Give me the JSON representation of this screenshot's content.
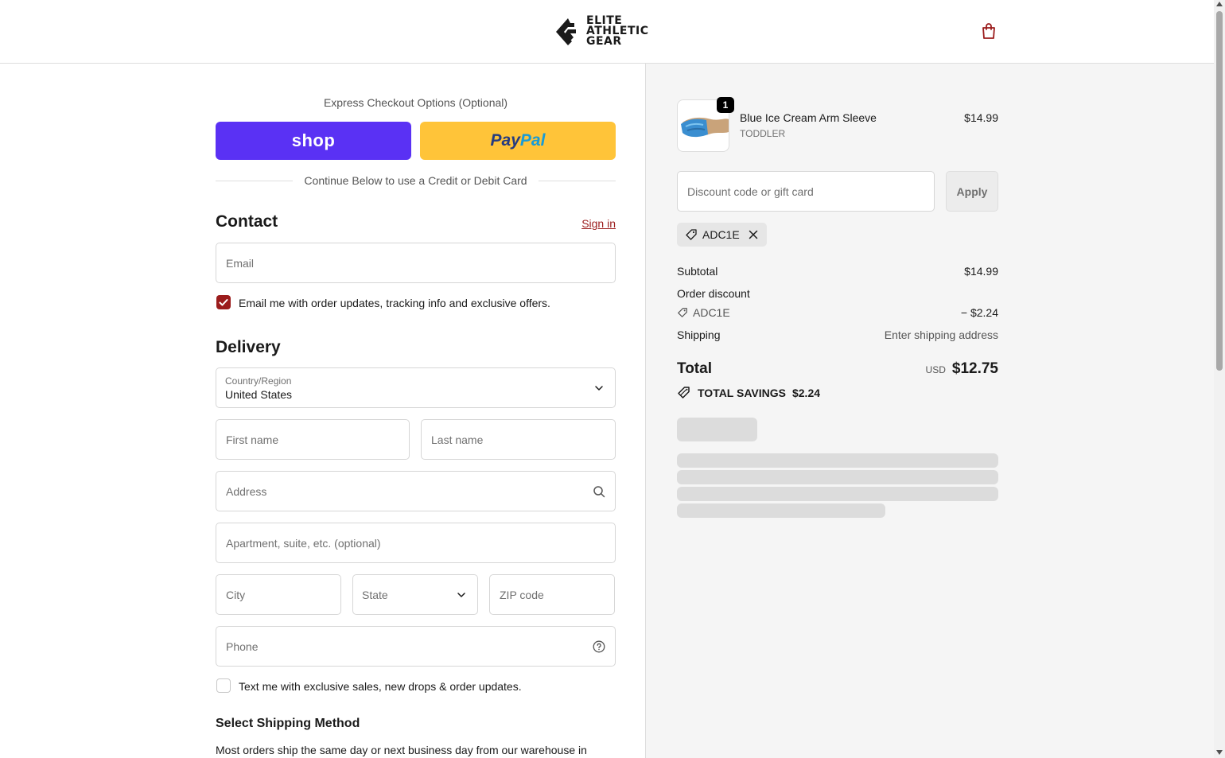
{
  "header": {
    "logo_lines": [
      "ELITE",
      "ATHLETIC",
      "GEAR"
    ],
    "cart_icon": "shopping-bag-icon"
  },
  "express": {
    "label": "Express Checkout Options (Optional)",
    "shop_label": "shop",
    "paypal_pay": "Pay",
    "paypal_pal": "Pal",
    "divider_text": "Continue Below to use a Credit or Debit Card"
  },
  "contact": {
    "title": "Contact",
    "sign_in": "Sign in",
    "email_placeholder": "Email",
    "email_optin": "Email me with order updates, tracking info and exclusive offers.",
    "email_optin_checked": true
  },
  "delivery": {
    "title": "Delivery",
    "country_label": "Country/Region",
    "country_value": "United States",
    "first_name_placeholder": "First name",
    "last_name_placeholder": "Last name",
    "address_placeholder": "Address",
    "apartment_placeholder": "Apartment, suite, etc. (optional)",
    "city_placeholder": "City",
    "state_label": "State",
    "zip_placeholder": "ZIP code",
    "phone_placeholder": "Phone",
    "sms_optin": "Text me with exclusive sales, new drops & order updates.",
    "sms_optin_checked": false
  },
  "shipping": {
    "title": "Select Shipping Method",
    "description": "Most orders ship the same day or next business day from our warehouse in"
  },
  "summary": {
    "product": {
      "name": "Blue Ice Cream Arm Sleeve",
      "variant": "TODDLER",
      "price": "$14.99",
      "quantity": "1"
    },
    "discount_placeholder": "Discount code or gift card",
    "apply_label": "Apply",
    "applied_code": "ADC1E",
    "subtotal_label": "Subtotal",
    "subtotal_value": "$14.99",
    "order_discount_label": "Order discount",
    "discount_code": "ADC1E",
    "discount_value": "− $2.24",
    "shipping_label": "Shipping",
    "shipping_value": "Enter shipping address",
    "total_label": "Total",
    "currency": "USD",
    "total_value": "$12.75",
    "savings_label": "TOTAL SAVINGS",
    "savings_value": "$2.24"
  },
  "colors": {
    "accent": "#9b1c1c",
    "shop_pay": "#5a31f4",
    "paypal": "#ffc439"
  }
}
